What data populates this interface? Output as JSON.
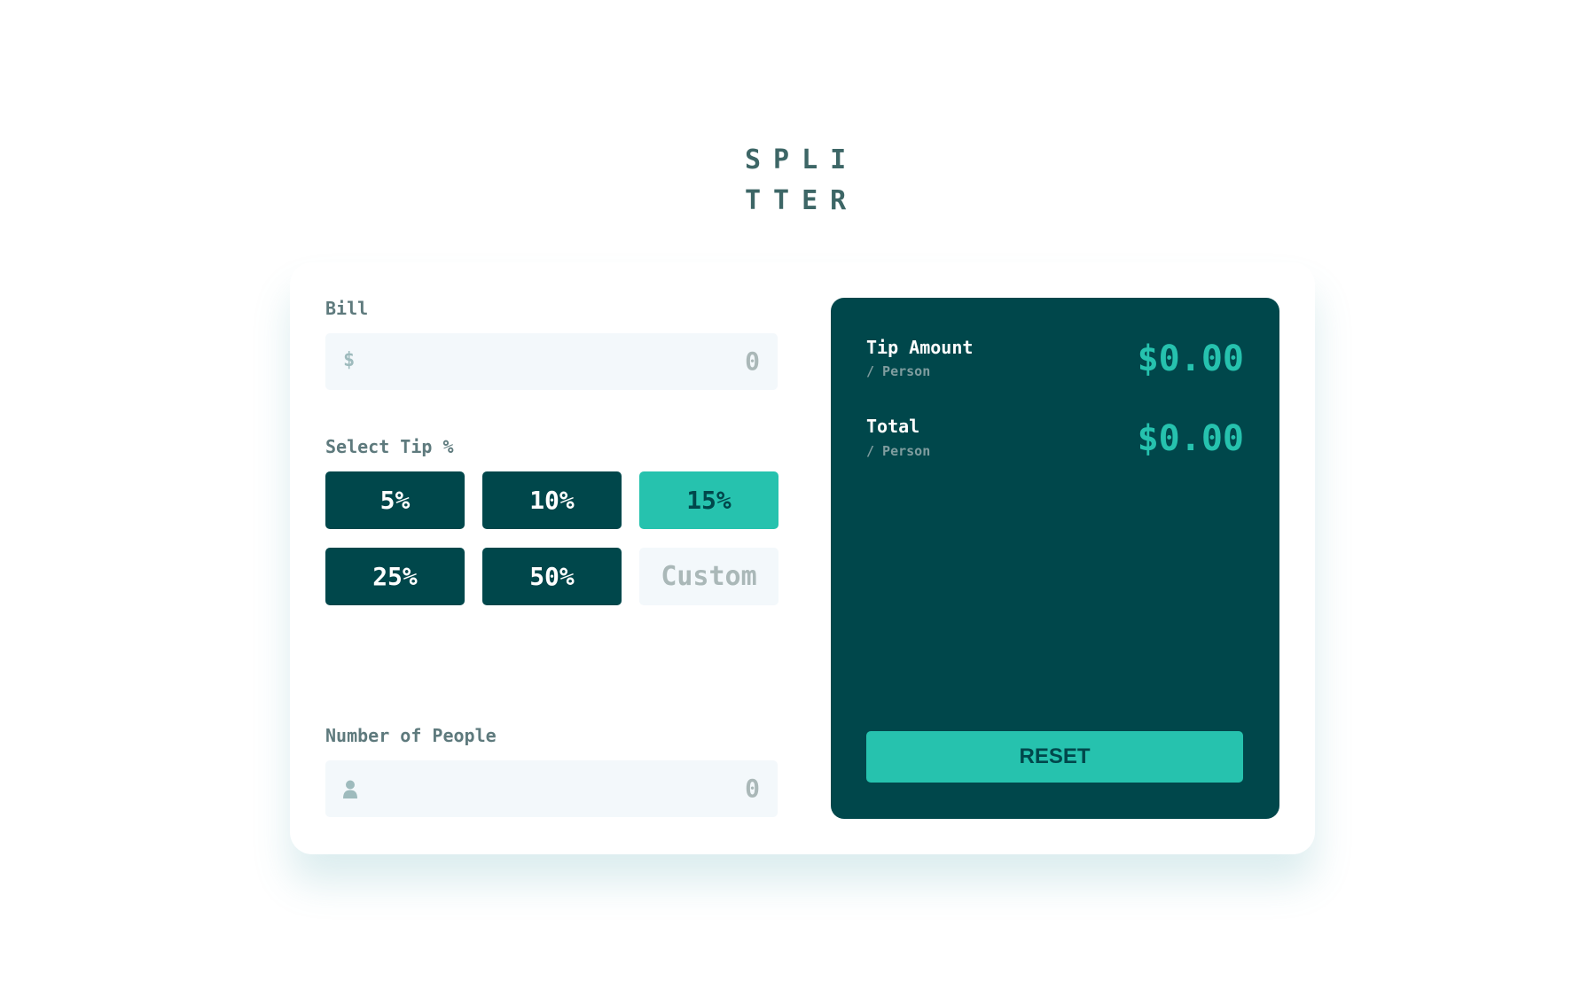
{
  "logo": {
    "line1": "SPLI",
    "line2": "TTER"
  },
  "bill": {
    "label": "Bill",
    "icon": "$",
    "value": "0"
  },
  "tip": {
    "label": "Select Tip %",
    "options": [
      "5%",
      "10%",
      "15%",
      "25%",
      "50%"
    ],
    "selected": "15%",
    "custom_placeholder": "Custom"
  },
  "people": {
    "label": "Number of People",
    "icon": "person-icon",
    "value": "0"
  },
  "results": {
    "tip_amount": {
      "title": "Tip Amount",
      "subtitle": "/ Person",
      "value": "$0.00"
    },
    "total": {
      "title": "Total",
      "subtitle": "/ Person",
      "value": "$0.00"
    },
    "reset_label": "RESET"
  },
  "colors": {
    "dark_cyan": "#00474b",
    "strong_cyan": "#26c2ae",
    "input_bg": "#f3f8fb",
    "label_gray": "#5e7a7d"
  }
}
